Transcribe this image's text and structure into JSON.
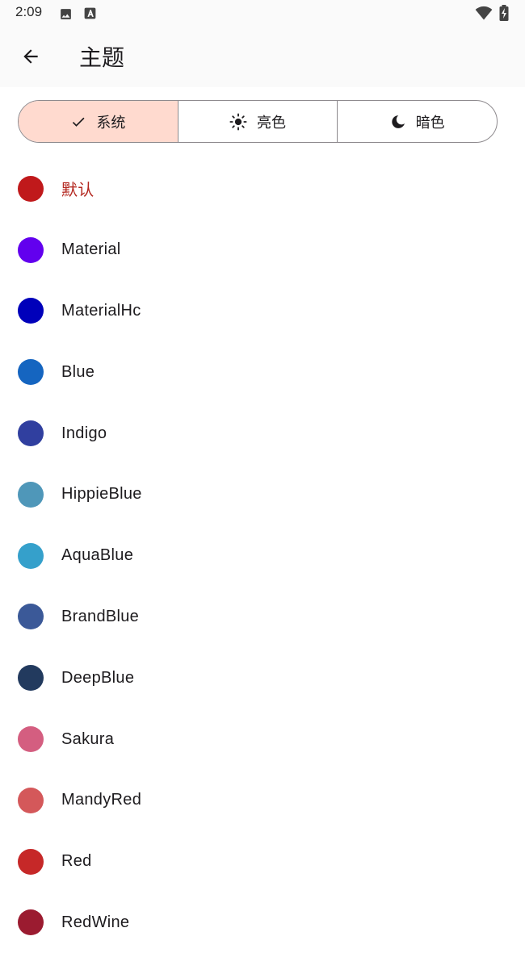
{
  "status_bar": {
    "time": "2:09",
    "icons": [
      "image-icon",
      "keyboard-a-icon",
      "wifi-icon",
      "battery-charging-icon"
    ]
  },
  "app_bar": {
    "back_icon": "arrow-left-icon",
    "title": "主题"
  },
  "mode_selector": {
    "options": [
      {
        "label": "系统",
        "icon": "check-icon",
        "selected": true
      },
      {
        "label": "亮色",
        "icon": "sun-icon",
        "selected": false
      },
      {
        "label": "暗色",
        "icon": "moon-icon",
        "selected": false
      }
    ],
    "selected_bg": "#ffdacf"
  },
  "themes": [
    {
      "label": "默认",
      "color": "#c0191b",
      "active": true
    },
    {
      "label": "Material",
      "color": "#6200ee",
      "active": false
    },
    {
      "label": "MaterialHc",
      "color": "#0000ba",
      "active": false
    },
    {
      "label": "Blue",
      "color": "#1565c0",
      "active": false
    },
    {
      "label": "Indigo",
      "color": "#303f9f",
      "active": false
    },
    {
      "label": "HippieBlue",
      "color": "#4f97b9",
      "active": false
    },
    {
      "label": "AquaBlue",
      "color": "#35a0cb",
      "active": false
    },
    {
      "label": "BrandBlue",
      "color": "#3b5998",
      "active": false
    },
    {
      "label": "DeepBlue",
      "color": "#223a5e",
      "active": false
    },
    {
      "label": "Sakura",
      "color": "#d45e80",
      "active": false
    },
    {
      "label": "MandyRed",
      "color": "#d4585a",
      "active": false
    },
    {
      "label": "Red",
      "color": "#c62828",
      "active": false
    },
    {
      "label": "RedWine",
      "color": "#9b1b30",
      "active": false
    }
  ]
}
